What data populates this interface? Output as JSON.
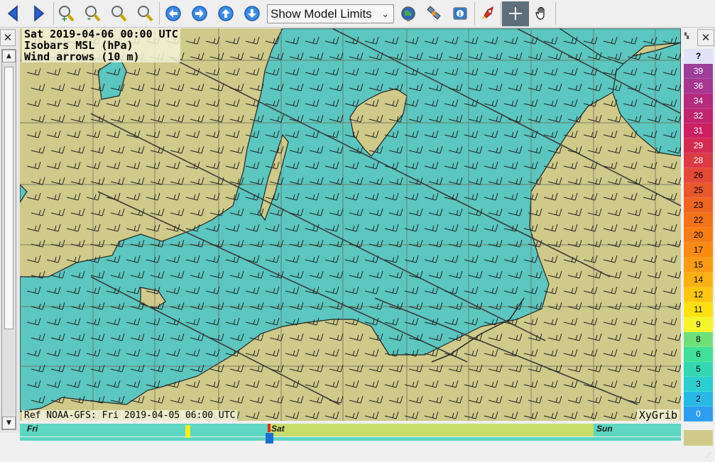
{
  "toolbar": {
    "buttons": [
      "back-arrow-icon",
      "forward-arrow-icon",
      "zoom-in-icon",
      "zoom-out-icon",
      "zoom-selection-icon",
      "zoom-fit-icon",
      "pan-left-icon",
      "pan-right-icon",
      "pan-up-icon",
      "pan-down-icon",
      "earth-icon",
      "satellite-icon",
      "info-icon",
      "rocket-icon",
      "crosshair-icon",
      "hand-icon"
    ],
    "model_select": "Show Model Limits"
  },
  "map": {
    "header_lines": [
      "Sat 2019-04-06 00:00 UTC",
      "Isobars MSL (hPa)",
      "Wind arrows (10 m)"
    ],
    "ref": "Ref NOAA-GFS: Fri 2019-04-05 06:00 UTC",
    "brand": "XyGrib",
    "colors": {
      "land": "#cfca8a",
      "sea": "#5bc7c0",
      "isobar": "#3a3a3a",
      "grid": "#6e6e5a"
    }
  },
  "timeline": {
    "days": [
      "Fri",
      "Sat",
      "Sun"
    ]
  },
  "legend": {
    "unknown_label": "?",
    "entries": [
      {
        "label": "39",
        "color": "#9c3e9a",
        "text": "#ffffff"
      },
      {
        "label": "36",
        "color": "#a8358e",
        "text": "#ffffff"
      },
      {
        "label": "34",
        "color": "#b52a7d",
        "text": "#ffffff"
      },
      {
        "label": "32",
        "color": "#c12370",
        "text": "#ffffff"
      },
      {
        "label": "31",
        "color": "#cc2060",
        "text": "#ffffff"
      },
      {
        "label": "29",
        "color": "#d52a50",
        "text": "#ffffff"
      },
      {
        "label": "28",
        "color": "#dd3a44",
        "text": "#ffffff"
      },
      {
        "label": "26",
        "color": "#e34a36",
        "text": "#000000"
      },
      {
        "label": "25",
        "color": "#e8582a",
        "text": "#000000"
      },
      {
        "label": "23",
        "color": "#ee6620",
        "text": "#000000"
      },
      {
        "label": "22",
        "color": "#f27218",
        "text": "#000000"
      },
      {
        "label": "20",
        "color": "#f67d12",
        "text": "#000000"
      },
      {
        "label": "17",
        "color": "#f98c10",
        "text": "#000000"
      },
      {
        "label": "15",
        "color": "#fb9c10",
        "text": "#000000"
      },
      {
        "label": "14",
        "color": "#fcb010",
        "text": "#000000"
      },
      {
        "label": "12",
        "color": "#fdc610",
        "text": "#000000"
      },
      {
        "label": "11",
        "color": "#fde010",
        "text": "#000000"
      },
      {
        "label": "9",
        "color": "#f6f42a",
        "text": "#000000"
      },
      {
        "label": "8",
        "color": "#6fe079",
        "text": "#000000"
      },
      {
        "label": "6",
        "color": "#3fe09a",
        "text": "#000000"
      },
      {
        "label": "5",
        "color": "#33d8b2",
        "text": "#000000"
      },
      {
        "label": "3",
        "color": "#2ccfd0",
        "text": "#000000"
      },
      {
        "label": "2",
        "color": "#28b8e6",
        "text": "#000000"
      },
      {
        "label": "0",
        "color": "#2e9ef0",
        "text": "#ffffff"
      }
    ]
  }
}
